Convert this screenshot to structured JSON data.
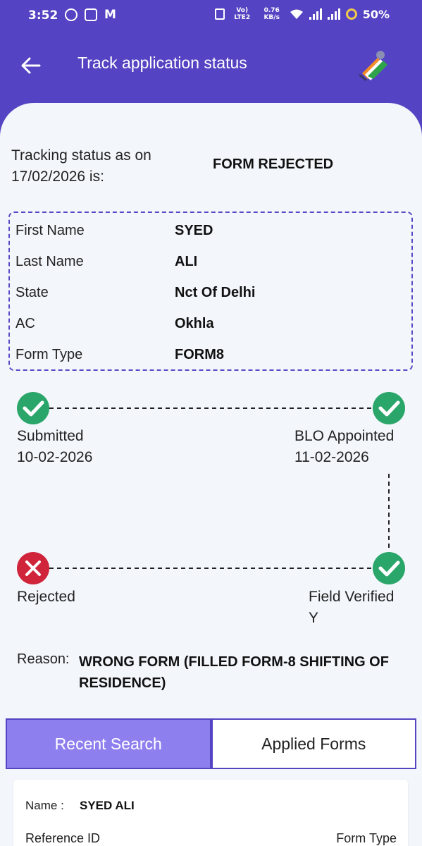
{
  "status_bar": {
    "time": "3:52",
    "volte": "Vo) LTE2",
    "speed": "0.76 KB/s",
    "battery": "50%"
  },
  "app_bar": {
    "title": "Track application status"
  },
  "tracking": {
    "label": "Tracking status as on 17/02/2026 is:",
    "status": "FORM REJECTED"
  },
  "details": [
    {
      "label": "First Name",
      "value": "SYED"
    },
    {
      "label": "Last Name",
      "value": "ALI"
    },
    {
      "label": "State",
      "value": "Nct Of Delhi"
    },
    {
      "label": "AC",
      "value": "Okhla"
    },
    {
      "label": "Form Type",
      "value": "FORM8"
    }
  ],
  "timeline": {
    "submitted": {
      "label": "Submitted",
      "date": "10-02-2026",
      "state": "done"
    },
    "blo": {
      "label": "BLO Appointed",
      "date": "11-02-2026",
      "state": "done"
    },
    "field": {
      "label": "Field Verified",
      "date": "Y",
      "state": "done"
    },
    "rejected": {
      "label": "Rejected",
      "state": "failed"
    }
  },
  "reason": {
    "label": "Reason:",
    "text": "WRONG FORM (FILLED FORM-8 SHIFTING OF RESIDENCE)"
  },
  "tabs": [
    {
      "label": "Recent Search",
      "active": true
    },
    {
      "label": "Applied Forms",
      "active": false
    }
  ],
  "result": {
    "name_label": "Name :",
    "name_value": "SYED ALI",
    "ref_label": "Reference ID",
    "form_type_label": "Form Type"
  },
  "colors": {
    "primary": "#5443c2",
    "tab_active": "#8d80ee",
    "success": "#2aa66a",
    "error": "#d0243b",
    "background": "#f3f7fb"
  }
}
